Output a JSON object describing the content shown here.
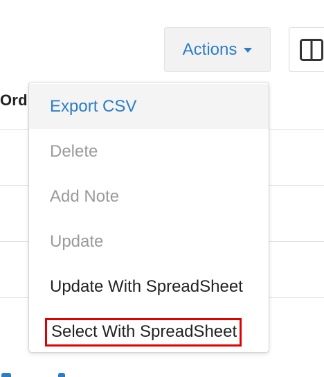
{
  "background": {
    "column_header": "Ord"
  },
  "toolbar": {
    "actions_label": "Actions"
  },
  "menu": {
    "items": [
      {
        "label": "Export CSV",
        "state": "highlighted"
      },
      {
        "label": "Delete",
        "state": "disabled"
      },
      {
        "label": "Add Note",
        "state": "disabled"
      },
      {
        "label": "Update",
        "state": "disabled"
      },
      {
        "label": "Update With SpreadSheet",
        "state": "enabled"
      },
      {
        "label": "Select With SpreadSheet",
        "state": "enabled",
        "annotated": true
      }
    ]
  },
  "colors": {
    "accent": "#2b7dc9",
    "disabled_text": "#9a9a9a",
    "annotation_box": "#e10000"
  },
  "icons": {
    "actions_caret": "caret-down-icon",
    "columns_toggle": "columns-icon"
  }
}
